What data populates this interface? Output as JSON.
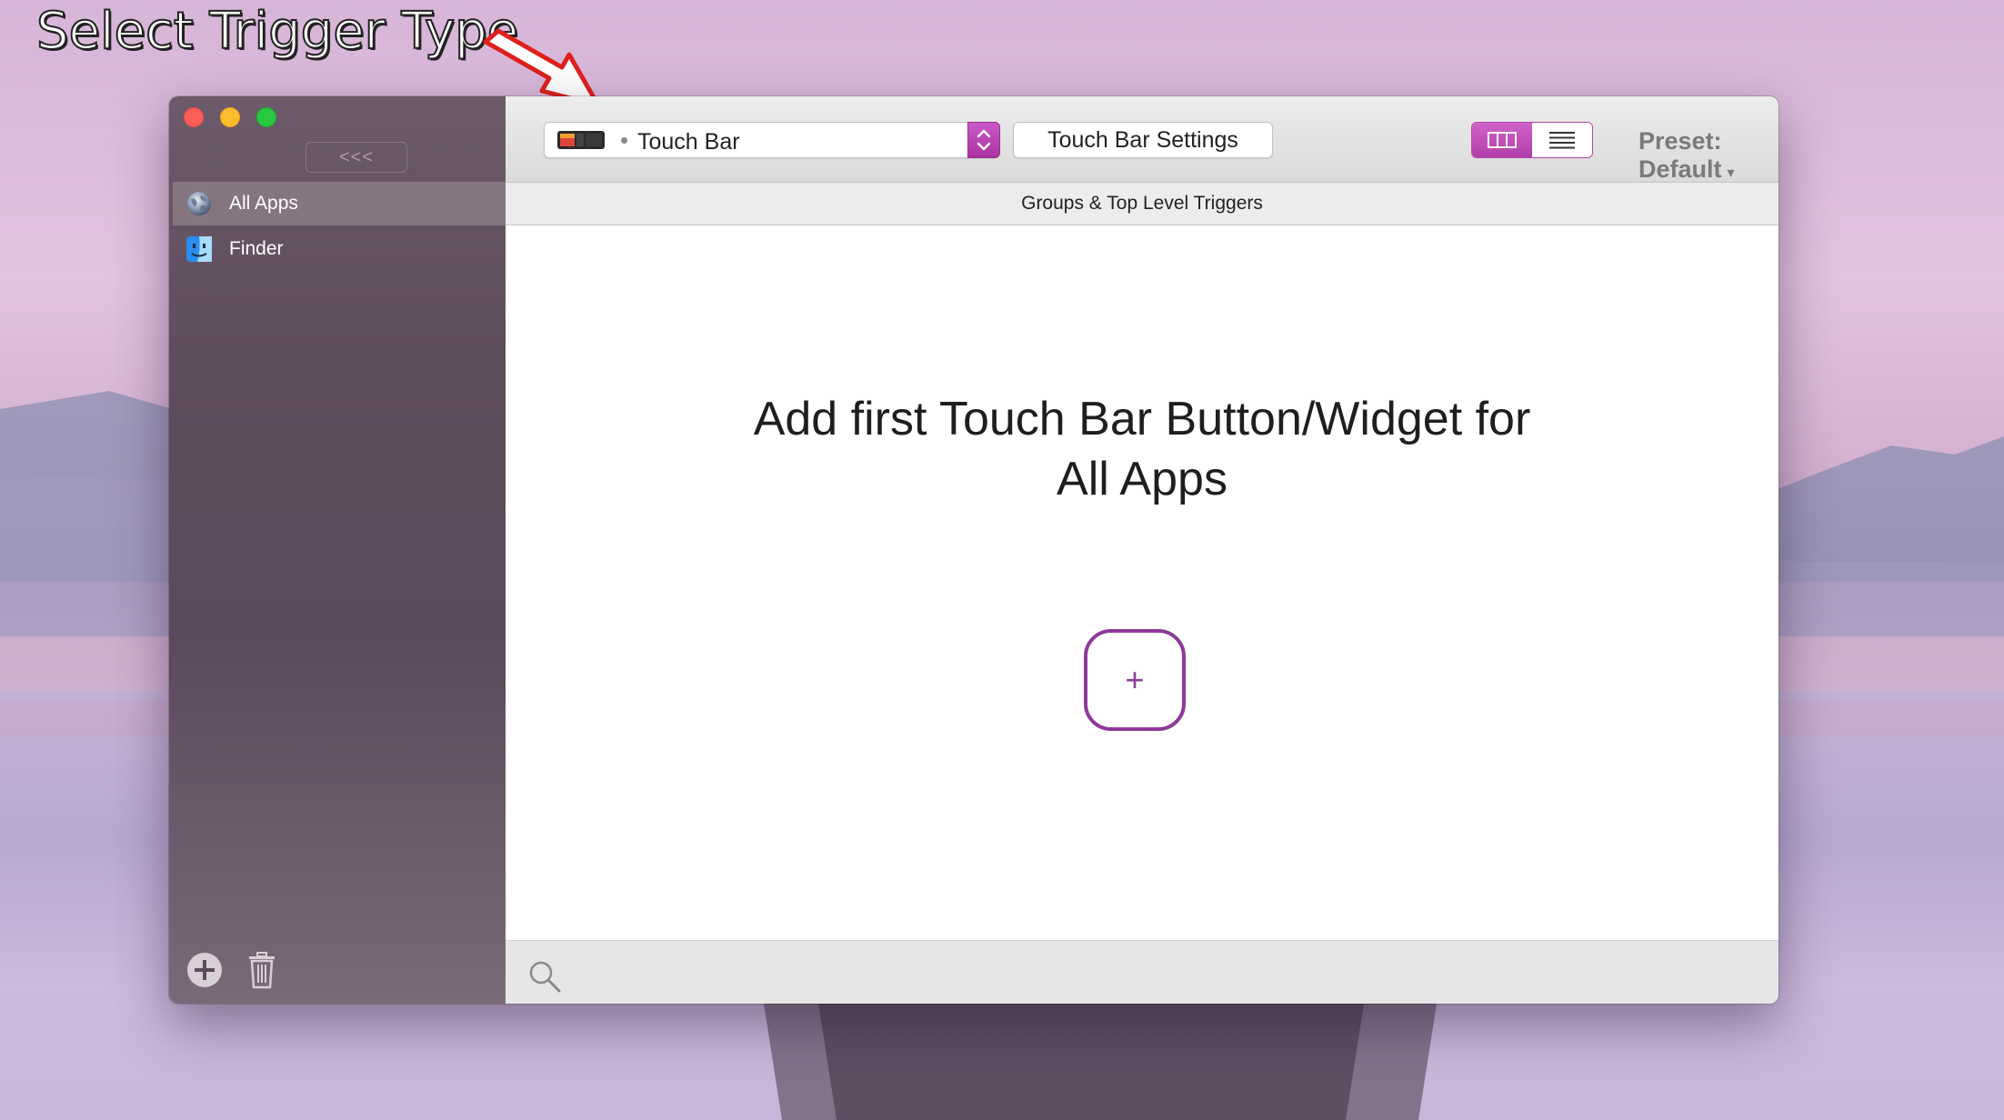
{
  "annotation": {
    "text": "Select Trigger Type"
  },
  "window": {
    "traffic_lights": [
      "close",
      "minimize",
      "zoom"
    ],
    "sidebar": {
      "collapse_label": "<<<",
      "items": [
        {
          "label": "All Apps",
          "icon": "globe-icon",
          "selected": true
        },
        {
          "label": "Finder",
          "icon": "finder-icon",
          "selected": false
        }
      ],
      "bottom": {
        "add_icon": "plus-circle-icon",
        "delete_icon": "trash-icon"
      }
    },
    "toolbar": {
      "trigger_type": "Touch Bar",
      "settings_label": "Touch Bar Settings",
      "view_modes": [
        "grid-view-icon",
        "list-view-icon"
      ],
      "active_view": "grid-view-icon",
      "preset_label": "Preset: Default",
      "preset_caret": "▾"
    },
    "subheader": "Groups & Top Level Triggers",
    "content": {
      "empty_line1": "Add first Touch Bar Button/Widget for",
      "empty_line2": "All Apps",
      "add_label": "+"
    },
    "colors": {
      "accent": "#b23ea8",
      "add_button": "#8e3a9a"
    }
  }
}
